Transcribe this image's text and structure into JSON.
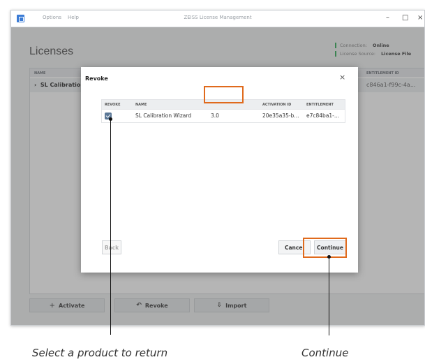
{
  "window": {
    "menu": [
      "Options",
      "Help"
    ],
    "title": "ZEISS License Management",
    "controls": {
      "minimize": "–",
      "maximize": "□",
      "close": "×"
    }
  },
  "page": {
    "title": "Licenses",
    "connection_label": "Connection:",
    "connection_value": "Online",
    "source_label": "License Source:",
    "source_value": "License File"
  },
  "list": {
    "columns": {
      "name": "NAME",
      "entitlement": "ENTITLEMENT ID"
    },
    "row": {
      "expander": "›",
      "name": "SL Calibration",
      "entitlement": "c846a1-f99c-4a..."
    }
  },
  "actions": {
    "activate": {
      "icon": "+",
      "label": "Activate"
    },
    "revoke": {
      "icon": "↶",
      "label": "Revoke"
    },
    "import": {
      "icon": "⇩",
      "label": "Import"
    }
  },
  "dialog": {
    "title": "Revoke",
    "close": "×",
    "columns": [
      "REVOKE",
      "NAME",
      "ACTIVATION ID",
      "ENTITLEMENT"
    ],
    "row": {
      "checked": true,
      "name": "SL Calibration Wizard",
      "version": "3.0",
      "activation_id": "20e35a35-b...",
      "entitlement": "e7c84ba1-..."
    },
    "back_label": "Back",
    "cancel_label": "Cancel",
    "continue_label": "Continue"
  },
  "annotations": {
    "select_caption": "Select a product to return",
    "continue_caption": "Continue",
    "highlight_color": "#e06a1c"
  }
}
